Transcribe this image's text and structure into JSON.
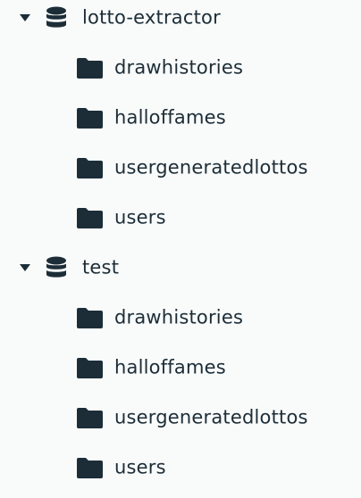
{
  "colors": {
    "background": "#f9fbfa",
    "text": "#1c2d38",
    "icon": "#1c2d38"
  },
  "databases": [
    {
      "name": "lotto-extractor",
      "expanded": true,
      "caret_icon": "caret-down-icon",
      "icon": "database-icon",
      "collections": [
        {
          "name": "drawhistories",
          "icon": "folder-icon"
        },
        {
          "name": "halloffames",
          "icon": "folder-icon"
        },
        {
          "name": "usergeneratedlottos",
          "icon": "folder-icon"
        },
        {
          "name": "users",
          "icon": "folder-icon"
        }
      ]
    },
    {
      "name": "test",
      "expanded": true,
      "caret_icon": "caret-down-icon",
      "icon": "database-icon",
      "collections": [
        {
          "name": "drawhistories",
          "icon": "folder-icon"
        },
        {
          "name": "halloffames",
          "icon": "folder-icon"
        },
        {
          "name": "usergeneratedlottos",
          "icon": "folder-icon"
        },
        {
          "name": "users",
          "icon": "folder-icon"
        }
      ]
    }
  ]
}
